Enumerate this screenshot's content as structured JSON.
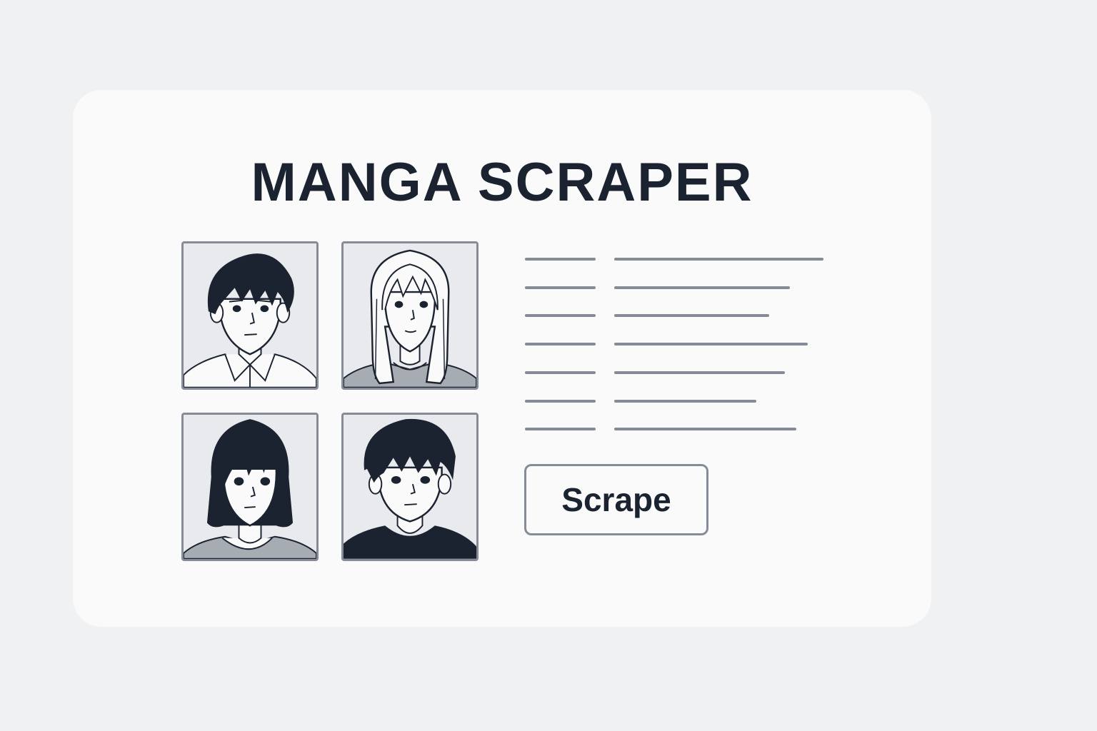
{
  "app": {
    "title": "MANGA SCRAPER"
  },
  "thumbnails": [
    {
      "name": "character-thumbnail-boy-collared-shirt",
      "description_icon": "boy-portrait-icon"
    },
    {
      "name": "character-thumbnail-long-hair-girl",
      "description_icon": "girl-portrait-icon"
    },
    {
      "name": "character-thumbnail-bob-hair-girl",
      "description_icon": "girl-portrait-icon"
    },
    {
      "name": "character-thumbnail-boy-dark-shirt",
      "description_icon": "boy-portrait-icon"
    }
  ],
  "field_rows": 7,
  "actions": {
    "scrape_label": "Scrape"
  },
  "colors": {
    "background": "#f0f1f3",
    "card": "#fafafa",
    "text": "#1b2330",
    "border": "#868c97",
    "placeholder_line": "#858b96",
    "ink": "#1b2330"
  }
}
